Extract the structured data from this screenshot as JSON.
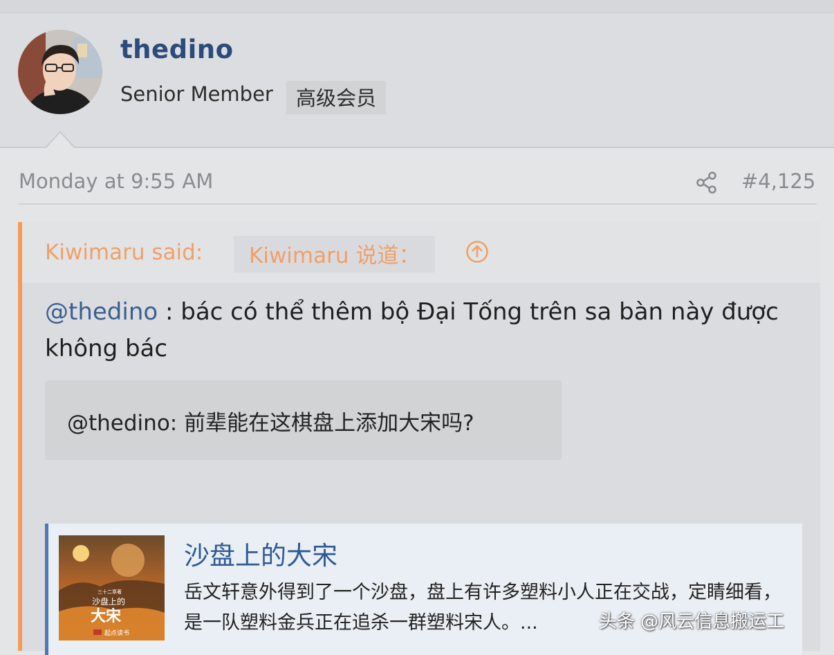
{
  "post": {
    "author": {
      "username": "thedino",
      "role": "Senior Member",
      "role_translation": "高级会员"
    },
    "timestamp": "Monday at 9:55 AM",
    "post_number": "#4,125",
    "icons": {
      "share": "share-icon",
      "quote_jump": "arrow-up-circle-icon"
    }
  },
  "quote": {
    "attribution": "Kiwimaru said:",
    "attribution_translation": "Kiwimaru 说道：",
    "mention": "@thedino",
    "body": " : bác có thể thêm bộ Đại Tống trên sa bàn này được không bác",
    "translation": "@thedino: 前辈能在这棋盘上添加大宋吗?",
    "link_card": {
      "title": "沙盘上的大宋",
      "description": "岳文轩意外得到了一个沙盘，盘上有许多塑料小人正在交战，定睛细看，是一队塑料金兵正在追杀一群塑料宋人。...",
      "cover_text_small": "三十二章著",
      "cover_text_top": "沙盘上的",
      "cover_text_big": "大宋",
      "cover_publisher": "起点读书"
    }
  },
  "watermark": "头条 @风云信息搬运工",
  "colors": {
    "username": "#2b4b7a",
    "quote_accent": "#f39c5a",
    "mention": "#3a5f8f",
    "card_accent": "#4d78b4"
  }
}
